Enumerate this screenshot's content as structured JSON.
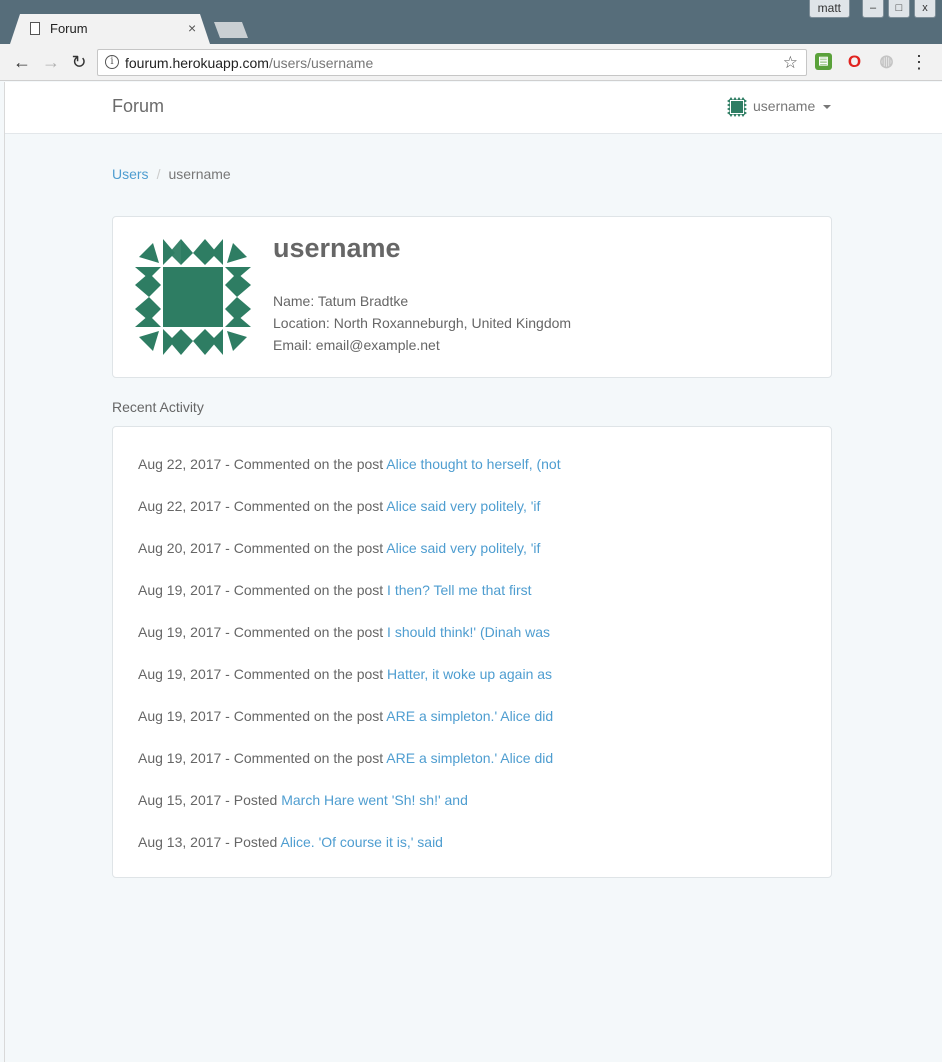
{
  "browser": {
    "os_user": "matt",
    "window_buttons": [
      "–",
      "□",
      "x"
    ],
    "tab_title": "Forum",
    "tab_close": "×",
    "url_host": "fourum.herokuapp.com",
    "url_path": "/users/username",
    "icons": {
      "back": "←",
      "forward": "→",
      "reload": "↻",
      "info": "i",
      "star": "☆",
      "menu": "⋮",
      "ext_print": "▤",
      "ext_opera": "O",
      "ext_ghost": "◍"
    }
  },
  "navbar": {
    "brand": "Forum",
    "username": "username"
  },
  "breadcrumb": {
    "parent": "Users",
    "separator": "/",
    "current": "username"
  },
  "profile": {
    "username": "username",
    "name_line": "Name: Tatum Bradtke",
    "location_line": "Location: North Roxanneburgh, United Kingdom",
    "email_line": "Email: email@example.net",
    "avatar_color": "#2e7d63"
  },
  "recent_activity": {
    "title": "Recent Activity",
    "items": [
      {
        "prefix": "Aug 22, 2017 - Commented on the post ",
        "link": "Alice thought to herself, (not"
      },
      {
        "prefix": "Aug 22, 2017 - Commented on the post ",
        "link": "Alice said very politely, 'if"
      },
      {
        "prefix": "Aug 20, 2017 - Commented on the post ",
        "link": "Alice said very politely, 'if"
      },
      {
        "prefix": "Aug 19, 2017 - Commented on the post ",
        "link": "I then? Tell me that first"
      },
      {
        "prefix": "Aug 19, 2017 - Commented on the post ",
        "link": "I should think!' (Dinah was"
      },
      {
        "prefix": "Aug 19, 2017 - Commented on the post ",
        "link": "Hatter, it woke up again as"
      },
      {
        "prefix": "Aug 19, 2017 - Commented on the post ",
        "link": "ARE a simpleton.' Alice did"
      },
      {
        "prefix": "Aug 19, 2017 - Commented on the post ",
        "link": "ARE a simpleton.' Alice did"
      },
      {
        "prefix": "Aug 15, 2017 - Posted ",
        "link": "March Hare went 'Sh! sh!' and"
      },
      {
        "prefix": "Aug 13, 2017 - Posted ",
        "link": "Alice. 'Of course it is,' said"
      }
    ]
  },
  "colors": {
    "link": "#4e9dd0",
    "avatar_green": "#2e7d63"
  }
}
